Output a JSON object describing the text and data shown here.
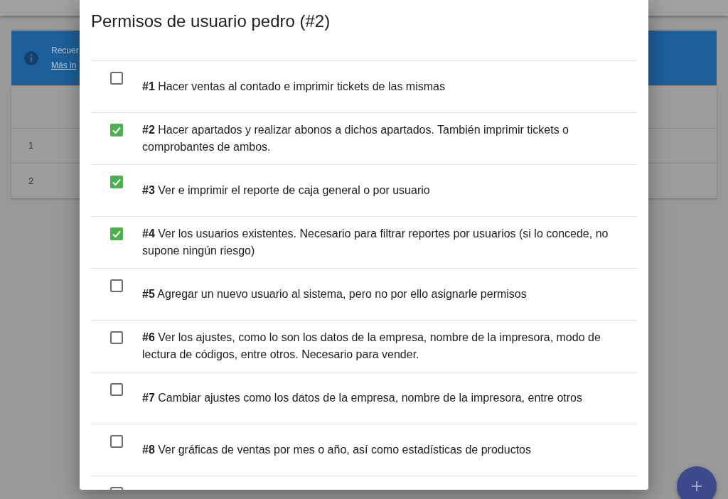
{
  "notice": {
    "text": "Recuer",
    "link": "Más in"
  },
  "table": {
    "rows": [
      {
        "cells": [
          "1"
        ]
      },
      {
        "cells": [
          "2"
        ]
      }
    ]
  },
  "dialog": {
    "title": "Permisos de usuario pedro (#2)",
    "permissions": [
      {
        "label": "**#1** Hacer ventas al contado e imprimir tickets de las mismas",
        "checked": false
      },
      {
        "label": "**#2** Hacer apartados y realizar abonos a dichos apartados. También imprimir tickets o comprobantes de ambos.",
        "checked": true
      },
      {
        "label": "**#3** Ver e imprimir el reporte de caja general o por usuario",
        "checked": true
      },
      {
        "label": "**#4** Ver los usuarios existentes. Necesario para filtrar reportes por usuarios (si lo concede, no supone ningún riesgo)",
        "checked": true
      },
      {
        "label": "**#5** Agregar un nuevo usuario al sistema, pero no por ello asignarle permisos",
        "checked": false
      },
      {
        "label": "**#6** Ver los ajustes, como lo son los datos de la empresa, nombre de la impresora, modo de lectura de códigos, entre otros. Necesario para vender.",
        "checked": false
      },
      {
        "label": "**#7** Cambiar ajustes como los datos de la empresa, nombre de la impresora, entre otros",
        "checked": false
      },
      {
        "label": "**#8** Ver gráficas de ventas por mes o año, así como estadísticas de productos",
        "checked": false
      },
      {
        "checked": false
      }
    ]
  }
}
